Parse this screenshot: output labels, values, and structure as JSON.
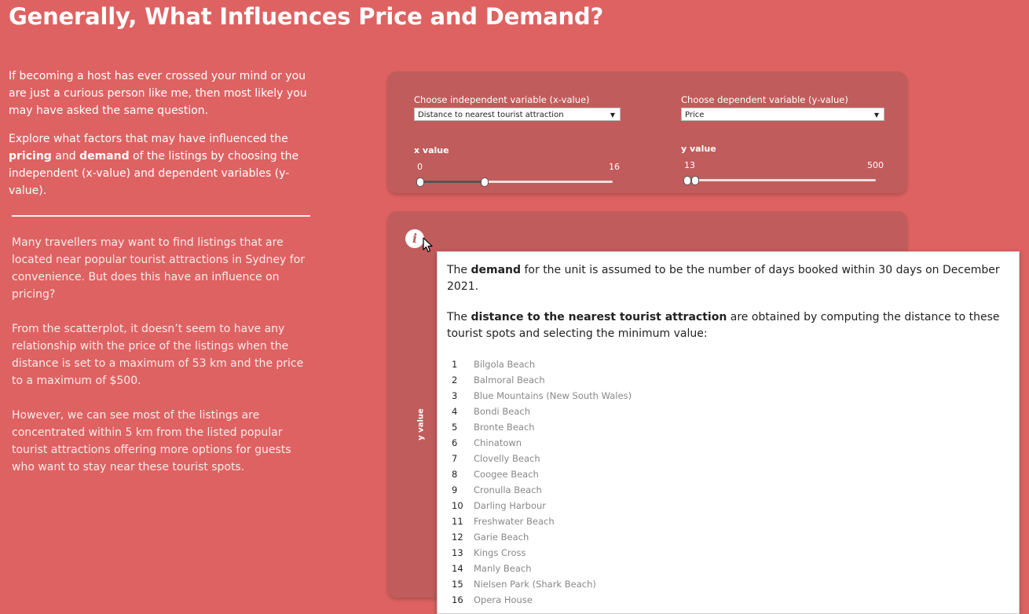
{
  "title": "Generally, What Influences Price and Demand?",
  "intro": {
    "p1": "If becoming a host has ever crossed your mind or you are just a curious person like me, then most likely you may have asked the same question.",
    "p2_a": "Explore what factors that may have influenced the ",
    "p2_b1": "pricing",
    "p2_c": " and ",
    "p2_b2": "demand",
    "p2_d": " of the listings by choosing the independent (x-value) and dependent variables (y-value)."
  },
  "story": {
    "p1": "Many travellers may want to find listings that are located near popular tourist attractions in Sydney for convenience. But does this have an influence on pricing?",
    "p2": "From the scatterplot, it doesn’t seem to have any relationship with the price of the listings when the distance is set to a maximum of 53 km and the price to a maximum of $500.",
    "p3": "However, we can see most of the listings are concentrated within 5 km from the listed popular tourist attractions offering more options for guests who want to stay near these tourist spots."
  },
  "controls": {
    "x_select_label": "Choose independent variable (x-value)",
    "x_select_value": "Distance to nearest tourist attraction",
    "y_select_label": "Choose dependent variable (y-value)",
    "y_select_value": "Price",
    "x_slider_title": "x value",
    "x_min": "0",
    "x_max": "16",
    "y_slider_title": "y value",
    "y_min": "13",
    "y_max": "500"
  },
  "chart": {
    "info_icon": "i",
    "y_axis_label": "y value"
  },
  "tooltip": {
    "demand_a": "The ",
    "demand_b": "demand",
    "demand_c": " for the unit is assumed to be the number of days booked within 30 days on December 2021.",
    "dist_a": "The ",
    "dist_b": "distance to the nearest tourist attraction",
    "dist_c": " are obtained by computing the distance to these tourist spots and selecting the minimum value:",
    "spots": [
      {
        "num": "1",
        "name": "Bilgola Beach"
      },
      {
        "num": "2",
        "name": "Balmoral Beach"
      },
      {
        "num": "3",
        "name": "Blue Mountains (New South Wales)"
      },
      {
        "num": "4",
        "name": "Bondi Beach"
      },
      {
        "num": "5",
        "name": "Bronte Beach"
      },
      {
        "num": "6",
        "name": "Chinatown"
      },
      {
        "num": "7",
        "name": "Clovelly Beach"
      },
      {
        "num": "8",
        "name": "Coogee Beach"
      },
      {
        "num": "9",
        "name": "Cronulla Beach"
      },
      {
        "num": "10",
        "name": "Darling Harbour"
      },
      {
        "num": "11",
        "name": "Freshwater Beach"
      },
      {
        "num": "12",
        "name": "Garie Beach"
      },
      {
        "num": "13",
        "name": "Kings Cross"
      },
      {
        "num": "14",
        "name": "Manly Beach"
      },
      {
        "num": "15",
        "name": "Nielsen Park (Shark Beach)"
      },
      {
        "num": "16",
        "name": "Opera House"
      }
    ]
  }
}
